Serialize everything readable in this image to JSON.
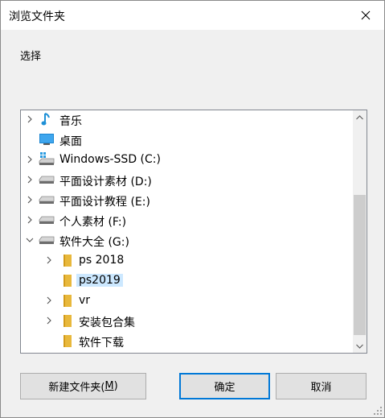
{
  "window": {
    "title": "浏览文件夹"
  },
  "prompt": "选择",
  "tree": {
    "items": [
      {
        "label": "音乐",
        "icon": "music-note-icon",
        "expander": "collapsed",
        "selected": false
      },
      {
        "label": "桌面",
        "icon": "desktop-icon",
        "expander": "none",
        "selected": false
      },
      {
        "label": "Windows-SSD (C:)",
        "icon": "windows-drive-icon",
        "expander": "collapsed",
        "selected": false
      },
      {
        "label": "平面设计素材 (D:)",
        "icon": "drive-icon",
        "expander": "collapsed",
        "selected": false
      },
      {
        "label": "平面设计教程 (E:)",
        "icon": "drive-icon",
        "expander": "collapsed",
        "selected": false
      },
      {
        "label": "个人素材 (F:)",
        "icon": "drive-icon",
        "expander": "collapsed",
        "selected": false
      },
      {
        "label": "软件大全 (G:)",
        "icon": "drive-icon",
        "expander": "expanded",
        "selected": false
      },
      {
        "label": "ps 2018",
        "icon": "folder-icon",
        "expander": "collapsed",
        "selected": false
      },
      {
        "label": "ps2019",
        "icon": "folder-icon",
        "expander": "none",
        "selected": true
      },
      {
        "label": "vr",
        "icon": "folder-icon",
        "expander": "collapsed",
        "selected": false
      },
      {
        "label": "安装包合集",
        "icon": "folder-icon",
        "expander": "collapsed",
        "selected": false
      },
      {
        "label": "软件下载",
        "icon": "folder-icon",
        "expander": "none",
        "selected": false
      }
    ]
  },
  "buttons": {
    "new_folder": "新建文件夹(",
    "new_folder_key": "M",
    "new_folder_end": ")",
    "ok": "确定",
    "cancel": "取消"
  },
  "colors": {
    "selection": "#cce8ff",
    "accent_border": "#0078d7",
    "folder": "#e8b83c",
    "music": "#1e90d6",
    "desktop": "#1c86d1"
  }
}
